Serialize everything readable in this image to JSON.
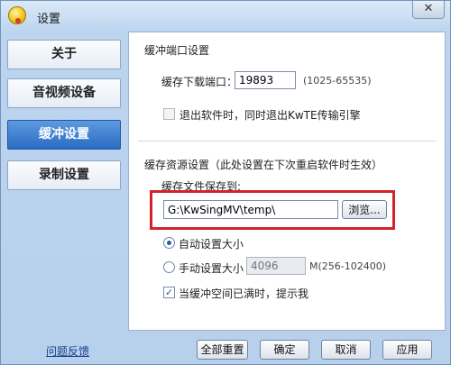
{
  "window": {
    "title": "设置",
    "close_glyph": "✕"
  },
  "sidebar": {
    "items": [
      {
        "label": "关于",
        "active": false
      },
      {
        "label": "音视频设备",
        "active": false
      },
      {
        "label": "缓冲设置",
        "active": true
      },
      {
        "label": "录制设置",
        "active": false
      }
    ]
  },
  "port_section": {
    "title": "缓冲端口设置",
    "port_label": "缓存下载端口：",
    "port_value": "19893",
    "port_range": "(1025-65535)",
    "exit_checkbox_label": "退出软件时，同时退出KwTE传输引擎",
    "exit_checked": false
  },
  "cache_section": {
    "title": "缓存资源设置（此处设置在下次重启软件时生效）",
    "path_label": "缓存文件保存到:",
    "path_value": "G:\\KwSingMV\\temp\\",
    "browse_label": "浏览...",
    "auto_size_label": "自动设置大小",
    "manual_size_label": "手动设置大小",
    "manual_size_value": "4096",
    "size_unit_range": "M(256-102400)",
    "notify_label": "当缓冲空间已满时，提示我",
    "notify_checked": true,
    "check_glyph": "✓"
  },
  "footer": {
    "feedback_link": "问题反馈",
    "reset_all": "全部重置",
    "ok": "确定",
    "cancel": "取消",
    "apply": "应用"
  },
  "colors": {
    "accent": "#2a6cc2",
    "highlight_border": "#d3232a"
  },
  "icons": {
    "app": "karaoke-app-icon",
    "close": "close-icon"
  }
}
